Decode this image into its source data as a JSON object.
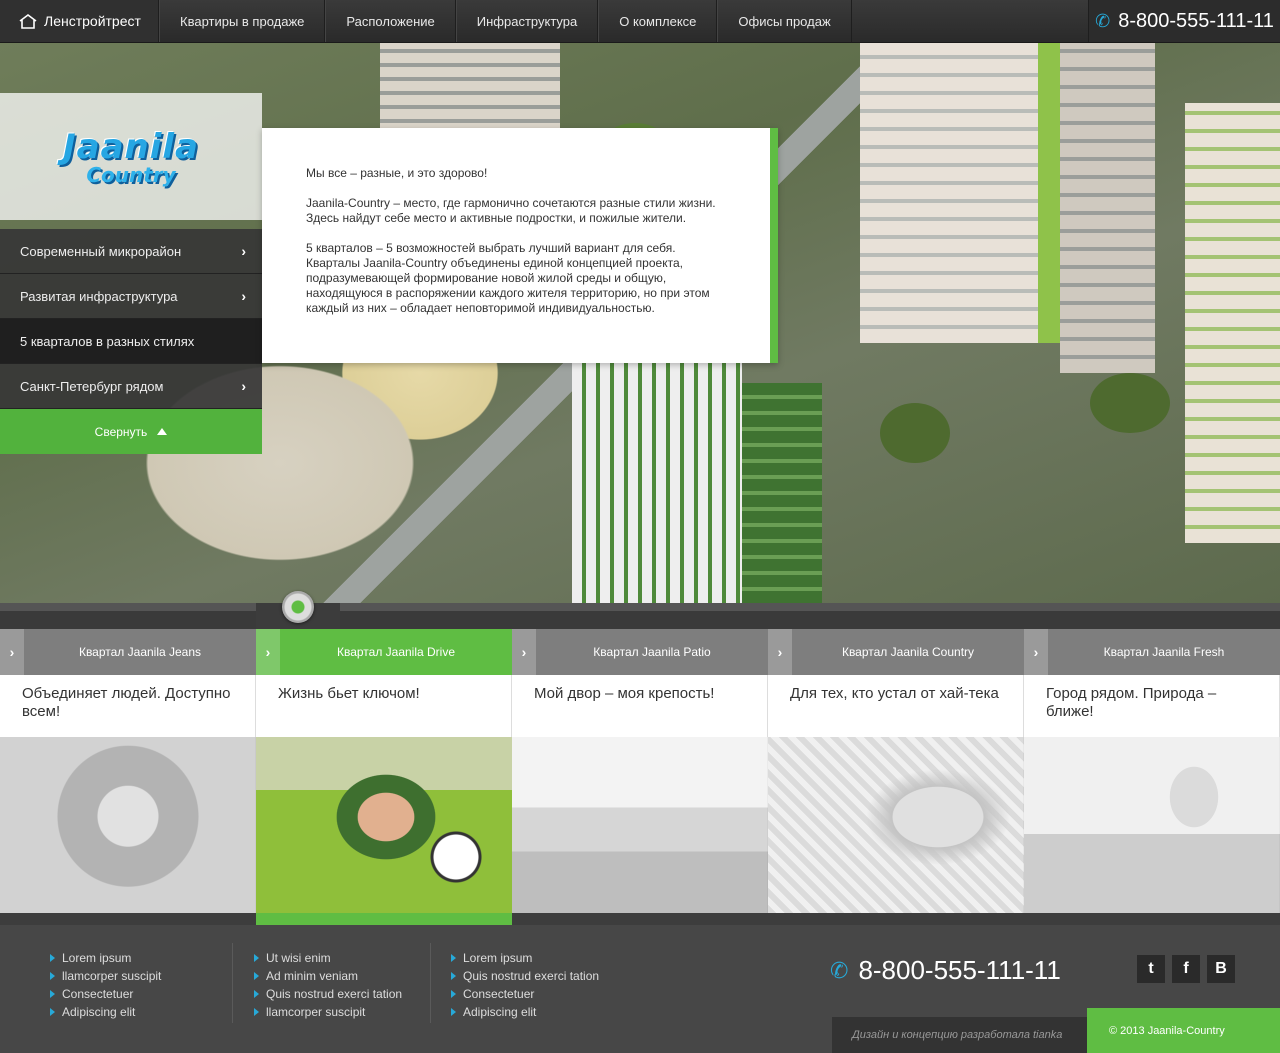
{
  "nav": {
    "brand": "Ленстройтрест",
    "items": [
      "Квартиры в продаже",
      "Расположение",
      "Инфраструктура",
      "О комплексе",
      "Офисы продаж"
    ],
    "phone": "8-800-555-111-11"
  },
  "logo": {
    "line1": "Jaanila",
    "line2": "Country"
  },
  "sidemenu": {
    "items": [
      {
        "label": "Современный микрорайон"
      },
      {
        "label": "Развитая инфраструктура"
      },
      {
        "label": "5 кварталов в разных стилях"
      },
      {
        "label": "Санкт-Петербург рядом"
      }
    ],
    "collapse": "Свернуть"
  },
  "info": {
    "p1": "Мы все – разные, и это здорово!",
    "p2": "Jaanila-Country – место, где гармонично сочетаются разные стили жизни. Здесь найдут себе место и активные подростки, и пожилые жители.",
    "p3": "5 кварталов – 5 возможностей выбрать лучший вариант для себя. Кварталы Jaanila-Country объединены единой концепцией проекта, подразумевающей формирование новой жилой среды и общую, находящуюся в распоряжении каждого жителя территорию, но при этом каждый из них – обладает неповторимой индивидуальностью."
  },
  "tabs": [
    {
      "label": "Квартал Jaanila Jeans",
      "text": "Объединяет людей. Доступно всем!"
    },
    {
      "label": "Квартал Jaanila Drive",
      "text": "Жизнь бьет ключом!"
    },
    {
      "label": "Квартал  Jaanila Patio",
      "text": "Мой двор – моя крепость!"
    },
    {
      "label": "Квартал Jaanila Country",
      "text": "Для тех, кто устал от хай-тека"
    },
    {
      "label": "Квартал Jaanila Fresh",
      "text": "Город рядом. Природа – ближе!"
    }
  ],
  "footer": {
    "col1": [
      "Lorem ipsum",
      "llamcorper suscipit",
      "Consectetuer",
      "Adipiscing elit"
    ],
    "col2": [
      "Ut wisi enim",
      "Ad minim veniam",
      "Quis nostrud exerci tation",
      "llamcorper suscipit"
    ],
    "col3": [
      "Lorem ipsum",
      "Quis nostrud exerci tation",
      "Consectetuer",
      "Adipiscing elit"
    ],
    "phone": "8-800-555-111-11",
    "social": [
      "t",
      "f",
      "B"
    ],
    "credit": "Дизайн и концепцию разработала tianka",
    "copyright": "© 2013 Jaanila-Country"
  },
  "colors": {
    "accent": "#5fbd43",
    "phone_icon": "#27a9d8"
  }
}
